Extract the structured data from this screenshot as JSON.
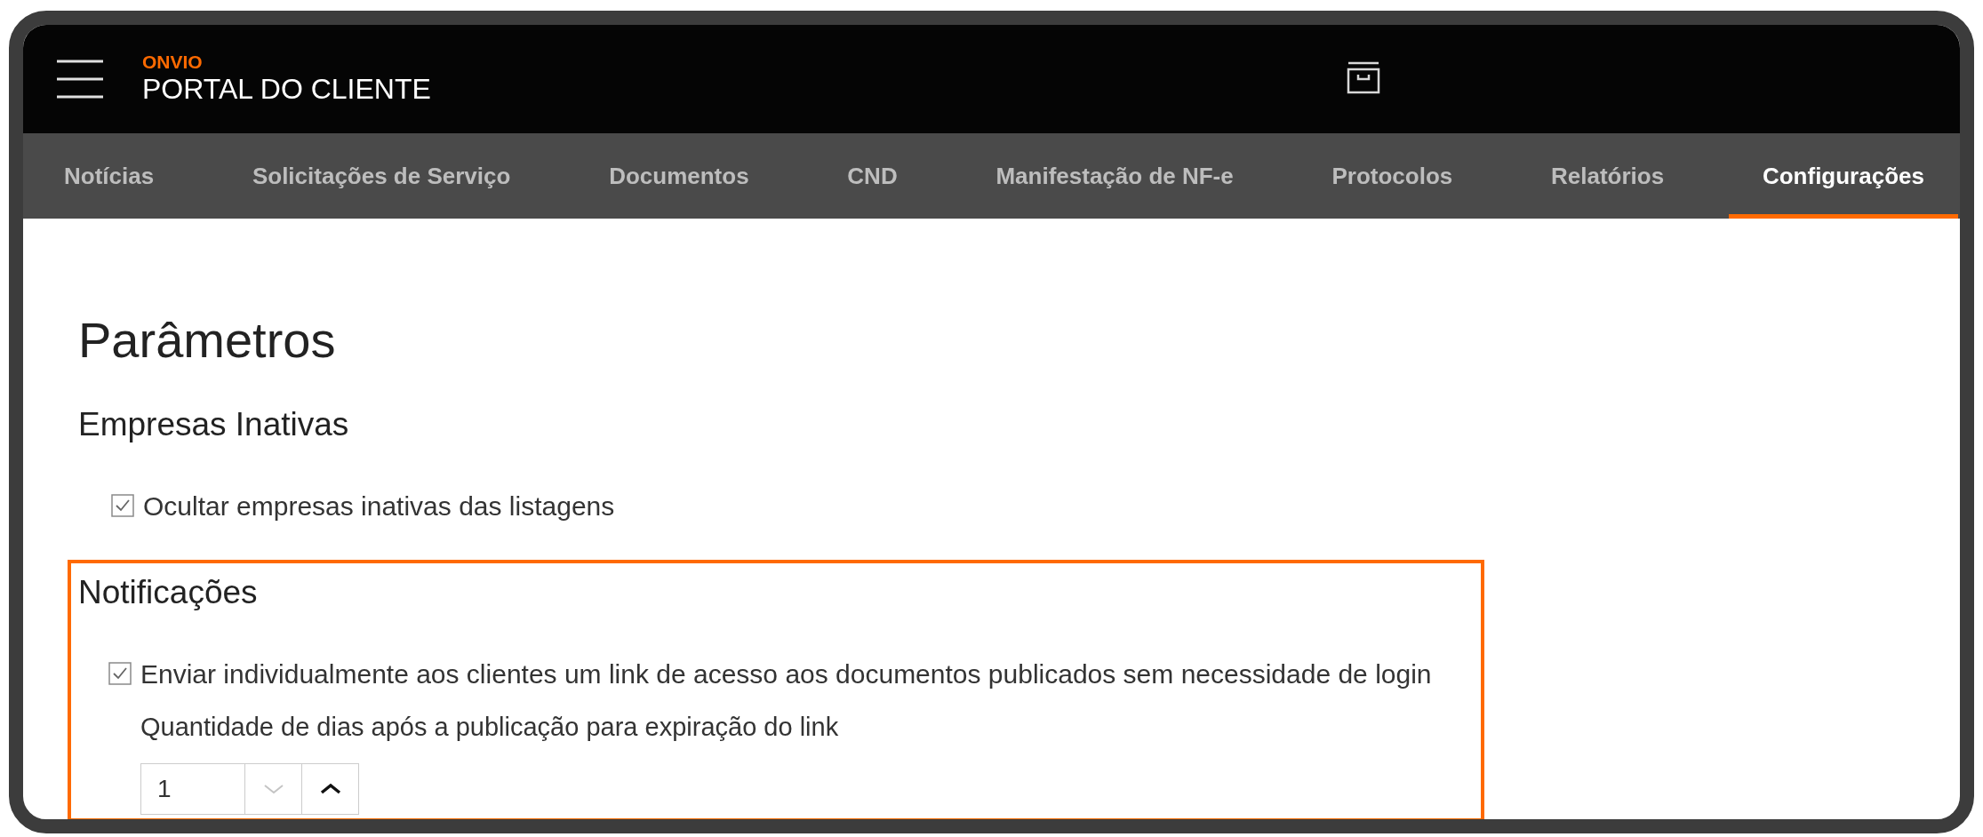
{
  "header": {
    "brand": "ONVIO",
    "title": "PORTAL DO CLIENTE"
  },
  "tabs": [
    {
      "label": "Notícias",
      "selected": false
    },
    {
      "label": "Solicitações de Serviço",
      "selected": false
    },
    {
      "label": "Documentos",
      "selected": false
    },
    {
      "label": "CND",
      "selected": false
    },
    {
      "label": "Manifestação de NF-e",
      "selected": false
    },
    {
      "label": "Protocolos",
      "selected": false
    },
    {
      "label": "Relatórios",
      "selected": false
    },
    {
      "label": "Configurações",
      "selected": true
    }
  ],
  "page_title": "Parâmetros",
  "sections": [
    {
      "title": "Empresas Inativas",
      "highlighted": false,
      "options": [
        {
          "label": "Ocultar empresas inativas das listagens",
          "checked": true
        }
      ]
    },
    {
      "title": "Notificações",
      "highlighted": true,
      "options": [
        {
          "label": "Enviar individualmente aos clientes um link de acesso aos documentos publicados sem necessidade de login",
          "checked": true
        }
      ],
      "field_label": "Quantidade de dias após a publicação para expiração do link",
      "spinner": {
        "value": "1",
        "decrement_disabled": true,
        "increment_disabled": false
      }
    }
  ]
}
